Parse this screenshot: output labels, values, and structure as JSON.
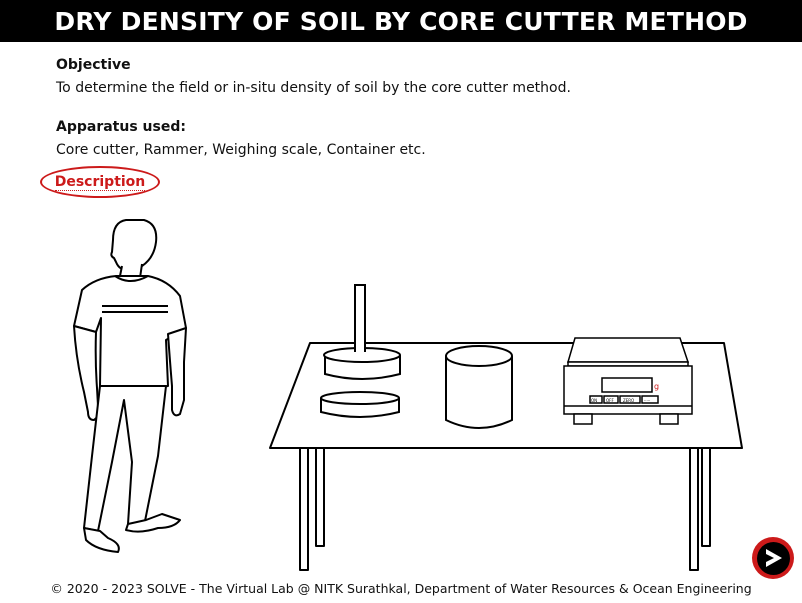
{
  "header": {
    "title": "DRY DENSITY OF SOIL BY CORE CUTTER METHOD"
  },
  "objective": {
    "heading": "Objective",
    "text": "To determine the field or in-situ density of soil by the core cutter method."
  },
  "apparatus": {
    "heading": "Apparatus used:",
    "text": "Core cutter, Rammer, Weighing scale, Container etc."
  },
  "description_link": {
    "label": "Description"
  },
  "scale": {
    "unit_label": "g",
    "buttons": [
      "ON",
      "OFF",
      "ZERO",
      "·····"
    ]
  },
  "footer": {
    "text": "© 2020 - 2023 SOLVE - The Virtual Lab @ NITK Surathkal, Department of Water Resources & Ocean Engineering"
  },
  "icons": {
    "next": "next-arrow-icon"
  },
  "colors": {
    "accent": "#cc1a1a",
    "header_bg": "#000000"
  }
}
